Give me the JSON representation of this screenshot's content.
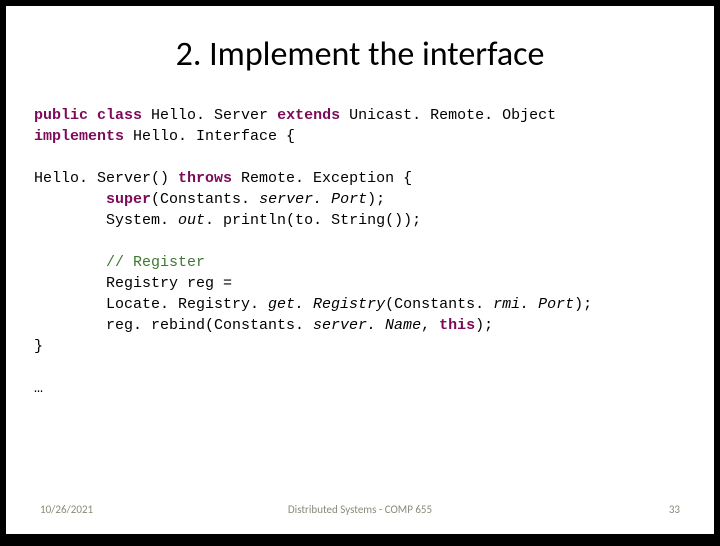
{
  "title": "2. Implement the interface",
  "code": {
    "l1a": "public class ",
    "l1b": "Hello. Server ",
    "l1c": "extends ",
    "l1d": "Unicast. Remote. Object",
    "l2a": "implements ",
    "l2b": "Hello. Interface {",
    "l4a": "Hello. Server() ",
    "l4b": "throws ",
    "l4c": "Remote. Exception {",
    "l5a": "        ",
    "l5b": "super",
    "l5c": "(Constants. ",
    "l5d": "server. Port",
    "l5e": ");",
    "l6a": "        System. ",
    "l6b": "out",
    "l6c": ". println(to. String());",
    "l8a": "        ",
    "l8b": "// Register",
    "l9a": "        Registry reg =",
    "l10a": "        Locate. Registry. ",
    "l10b": "get. Registry",
    "l10c": "(Constants. ",
    "l10d": "rmi. Port",
    "l10e": ");",
    "l11a": "        reg. rebind(Constants. ",
    "l11b": "server. Name",
    "l11c": ", ",
    "l11d": "this",
    "l11e": ");",
    "l12": "}",
    "l14": "…"
  },
  "footer": {
    "date": "10/26/2021",
    "center": "Distributed Systems - COMP 655",
    "page": "33"
  }
}
